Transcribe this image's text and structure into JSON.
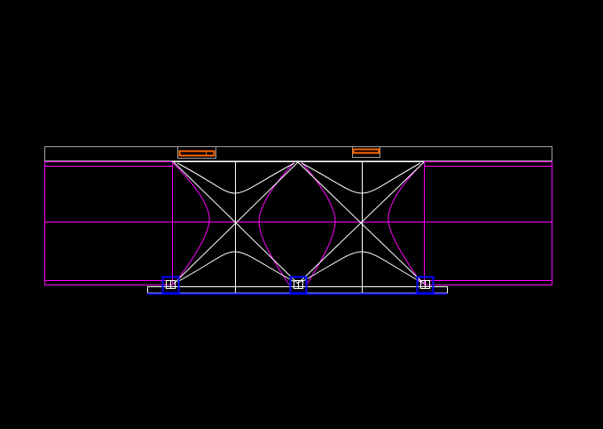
{
  "drawing": {
    "background_color": "#000000",
    "layers": {
      "outline": {
        "color": "#FFFFFF"
      },
      "beams": {
        "color": "#FF00FF"
      },
      "supports": {
        "color": "#0000FF"
      },
      "bearing_plates": {
        "color": "#FF6600"
      },
      "frame_lines": {
        "color": "#A0A0A0"
      }
    }
  }
}
